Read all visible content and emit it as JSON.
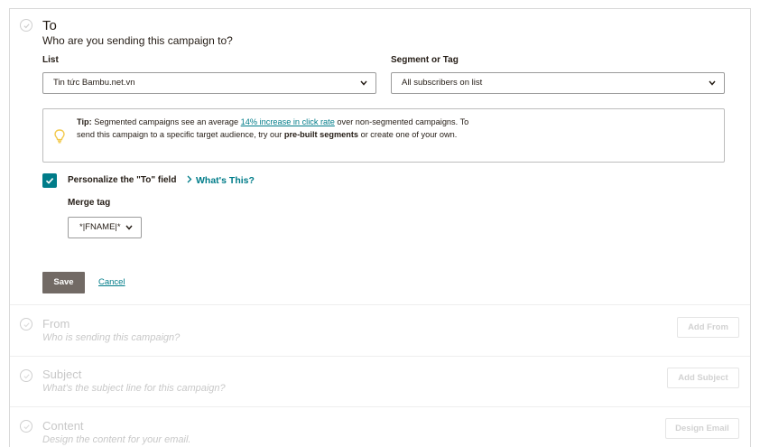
{
  "to": {
    "title": "To",
    "subtitle": "Who are you sending this campaign to?",
    "list_label": "List",
    "list_value": "Tin tức Bambu.net.vn",
    "segment_label": "Segment or Tag",
    "segment_value": "All subscribers on list",
    "tip": {
      "prefix": "Tip:",
      "text1": " Segmented campaigns see an average ",
      "link": "14% increase in click rate",
      "text2": " over non-segmented campaigns. To send this campaign to a specific target audience, try our ",
      "bold": "pre-built segments",
      "text3": " or create one of your own."
    },
    "personalize_label": "Personalize the \"To\" field",
    "personalize_checked": true,
    "whats_this": "What's This?",
    "merge_tag_label": "Merge tag",
    "merge_tag_value": "*|FNAME|*",
    "save_label": "Save",
    "cancel_label": "Cancel"
  },
  "from": {
    "title": "From",
    "subtitle": "Who is sending this campaign?",
    "button": "Add From"
  },
  "subject": {
    "title": "Subject",
    "subtitle": "What's the subject line for this campaign?",
    "button": "Add Subject"
  },
  "content": {
    "title": "Content",
    "subtitle": "Design the content for your email.",
    "button": "Design Email"
  },
  "colors": {
    "accent": "#007c89",
    "save_button": "#726a65",
    "tip_icon": "#f2c94c"
  },
  "icons": {
    "step": "check-circle-icon",
    "tip": "lightbulb-icon",
    "dropdown": "chevron-down-icon",
    "link_arrow": "chevron-right-icon"
  }
}
